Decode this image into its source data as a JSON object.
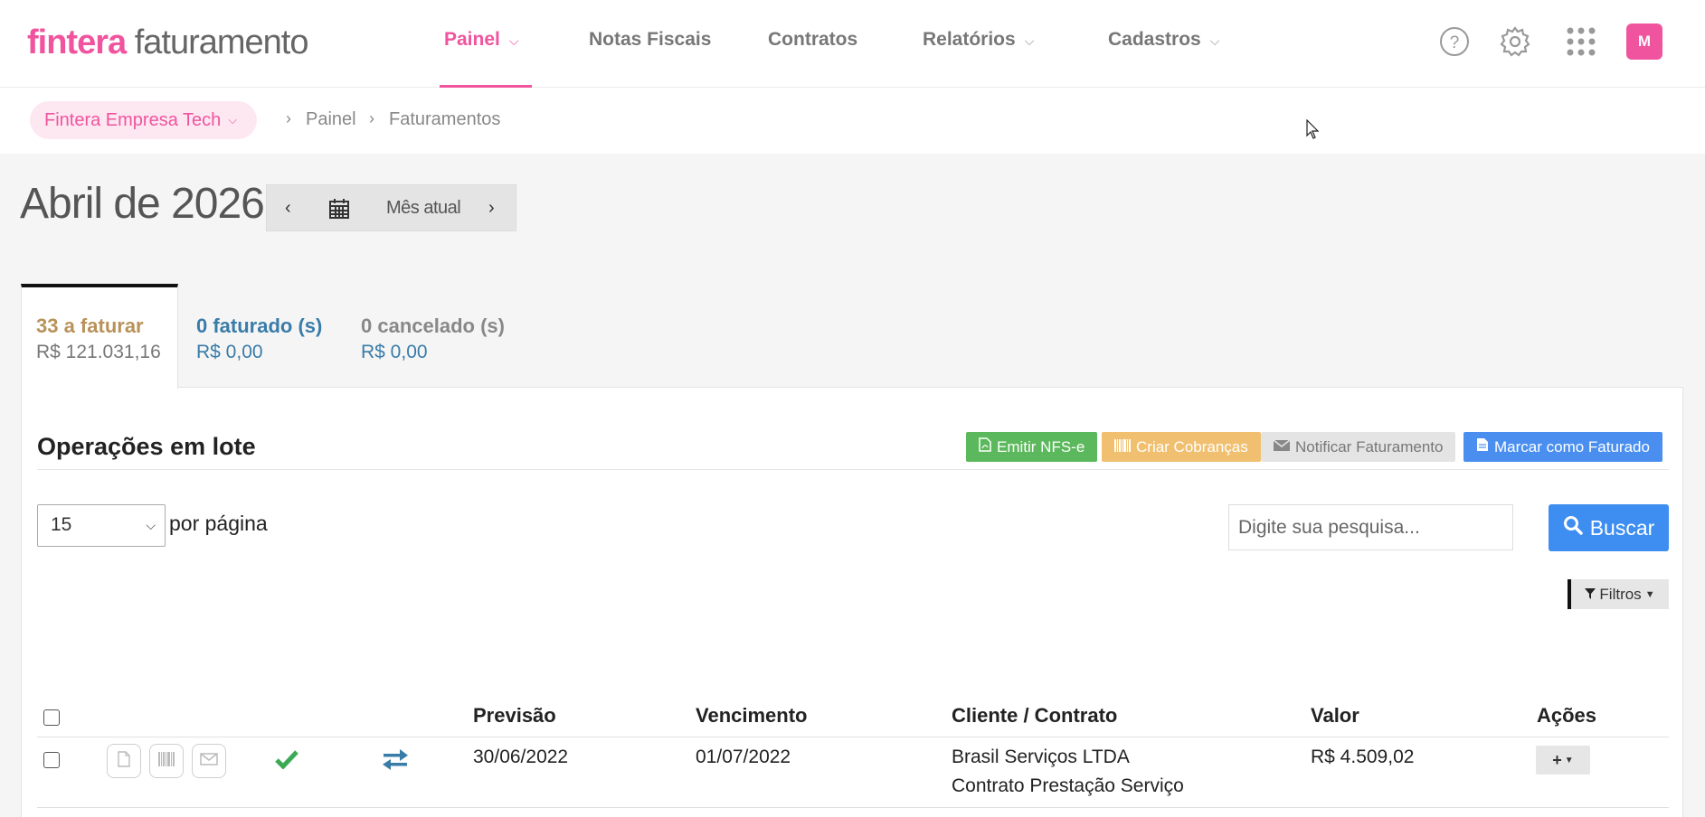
{
  "app": {
    "brand": "fintera",
    "product": "faturamento"
  },
  "nav": {
    "items": [
      {
        "label": "Painel",
        "dropdown": true,
        "active": true
      },
      {
        "label": "Notas Fiscais",
        "dropdown": false,
        "active": false
      },
      {
        "label": "Contratos",
        "dropdown": false,
        "active": false
      },
      {
        "label": "Relatórios",
        "dropdown": true,
        "active": false
      },
      {
        "label": "Cadastros",
        "dropdown": true,
        "active": false
      }
    ],
    "avatar_initial": "M",
    "icons": [
      "help-icon",
      "gear-icon",
      "apps-grid-icon"
    ]
  },
  "breadcrumb": {
    "company": "Fintera Empresa Tech",
    "items": [
      "Painel",
      "Faturamentos"
    ]
  },
  "period": {
    "title": "Abril de 2026",
    "label": "Mês atual"
  },
  "tabs": [
    {
      "title": "33 a faturar",
      "amount": "R$ 121.031,16",
      "active": true
    },
    {
      "title": "0 faturado (s)",
      "amount": "R$ 0,00",
      "active": false
    },
    {
      "title": "0 cancelado (s)",
      "amount": "R$ 0,00",
      "active": false
    }
  ],
  "bulk": {
    "title": "Operações em lote",
    "buttons": {
      "emit": "Emitir NFS-e",
      "charges": "Criar Cobranças",
      "notify": "Notificar Faturamento",
      "mark": "Marcar como Faturado"
    }
  },
  "list": {
    "per_page_value": "15",
    "per_page_label": "por página",
    "search_placeholder": "Digite sua pesquisa...",
    "search_button": "Buscar",
    "filters_button": "Filtros"
  },
  "table": {
    "columns": [
      "Previsão",
      "Vencimento",
      "Cliente / Contrato",
      "Valor",
      "Ações"
    ],
    "rows": [
      {
        "previsao": "30/06/2022",
        "vencimento": "01/07/2022",
        "cliente": "Brasil Serviços LTDA",
        "contrato": "Contrato Prestação Serviço",
        "valor": "R$ 4.509,02",
        "action": "+"
      }
    ]
  },
  "colors": {
    "brand_pink": "#f0549e",
    "green": "#5cb85c",
    "yellow": "#f0c070",
    "blue": "#3d8ef0",
    "tab_faturar": "#b8925a",
    "tab_faturado": "#3a7ca8",
    "tab_cancelado": "#888888"
  }
}
